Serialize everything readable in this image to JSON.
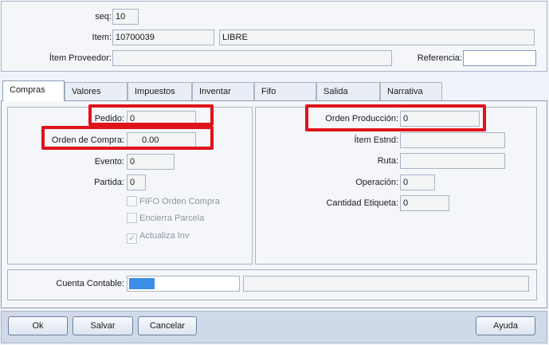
{
  "header": {
    "seq": {
      "label": "seq:",
      "value": "10"
    },
    "item": {
      "label": "Item:",
      "code": "10700039",
      "description": "LIBRE"
    },
    "item_proveedor": {
      "label": "Ítem Proveedor:",
      "value": ""
    },
    "referencia": {
      "label": "Referencia:",
      "value": ""
    }
  },
  "tabs": [
    {
      "label": "Compras",
      "active": true
    },
    {
      "label": "Valores"
    },
    {
      "label": "Impuestos"
    },
    {
      "label": "Inventar"
    },
    {
      "label": "Fifo"
    },
    {
      "label": "Salida"
    },
    {
      "label": "Narrativa"
    }
  ],
  "compras": {
    "left": {
      "pedido": {
        "label": "Pedido:",
        "value": "0"
      },
      "orden_compra": {
        "label": "Orden de Compra:",
        "value": "0.00"
      },
      "evento": {
        "label": "Evento:",
        "value": "0"
      },
      "partida": {
        "label": "Partida:",
        "value": "0"
      },
      "fifo_orden_compra": {
        "label": "FIFO Orden Compra",
        "checked": false
      },
      "encierra_parcela": {
        "label": "Encierra Parcela",
        "checked": false
      },
      "actualiza_inv": {
        "label": "Actualiza Inv",
        "checked": true
      }
    },
    "right": {
      "orden_produccion": {
        "label": "Orden Producción:",
        "value": "0"
      },
      "item_estnd": {
        "label": "Ítem Estnd:",
        "value": ""
      },
      "ruta": {
        "label": "Ruta:",
        "value": ""
      },
      "operacion": {
        "label": "Operación:",
        "value": "0"
      },
      "cantidad_etiqueta": {
        "label": "Cantidad Etiqueta:",
        "value": "0"
      }
    },
    "cuenta_contable": {
      "label": "Cuenta Contable:",
      "code": "",
      "description": ""
    }
  },
  "buttons": {
    "ok": "Ok",
    "salvar": "Salvar",
    "cancelar": "Cancelar",
    "ayuda": "Ayuda"
  },
  "colors": {
    "highlight": "#e0121a",
    "selection": "#3b8ee8",
    "button_bar": "#cfd9ea"
  }
}
